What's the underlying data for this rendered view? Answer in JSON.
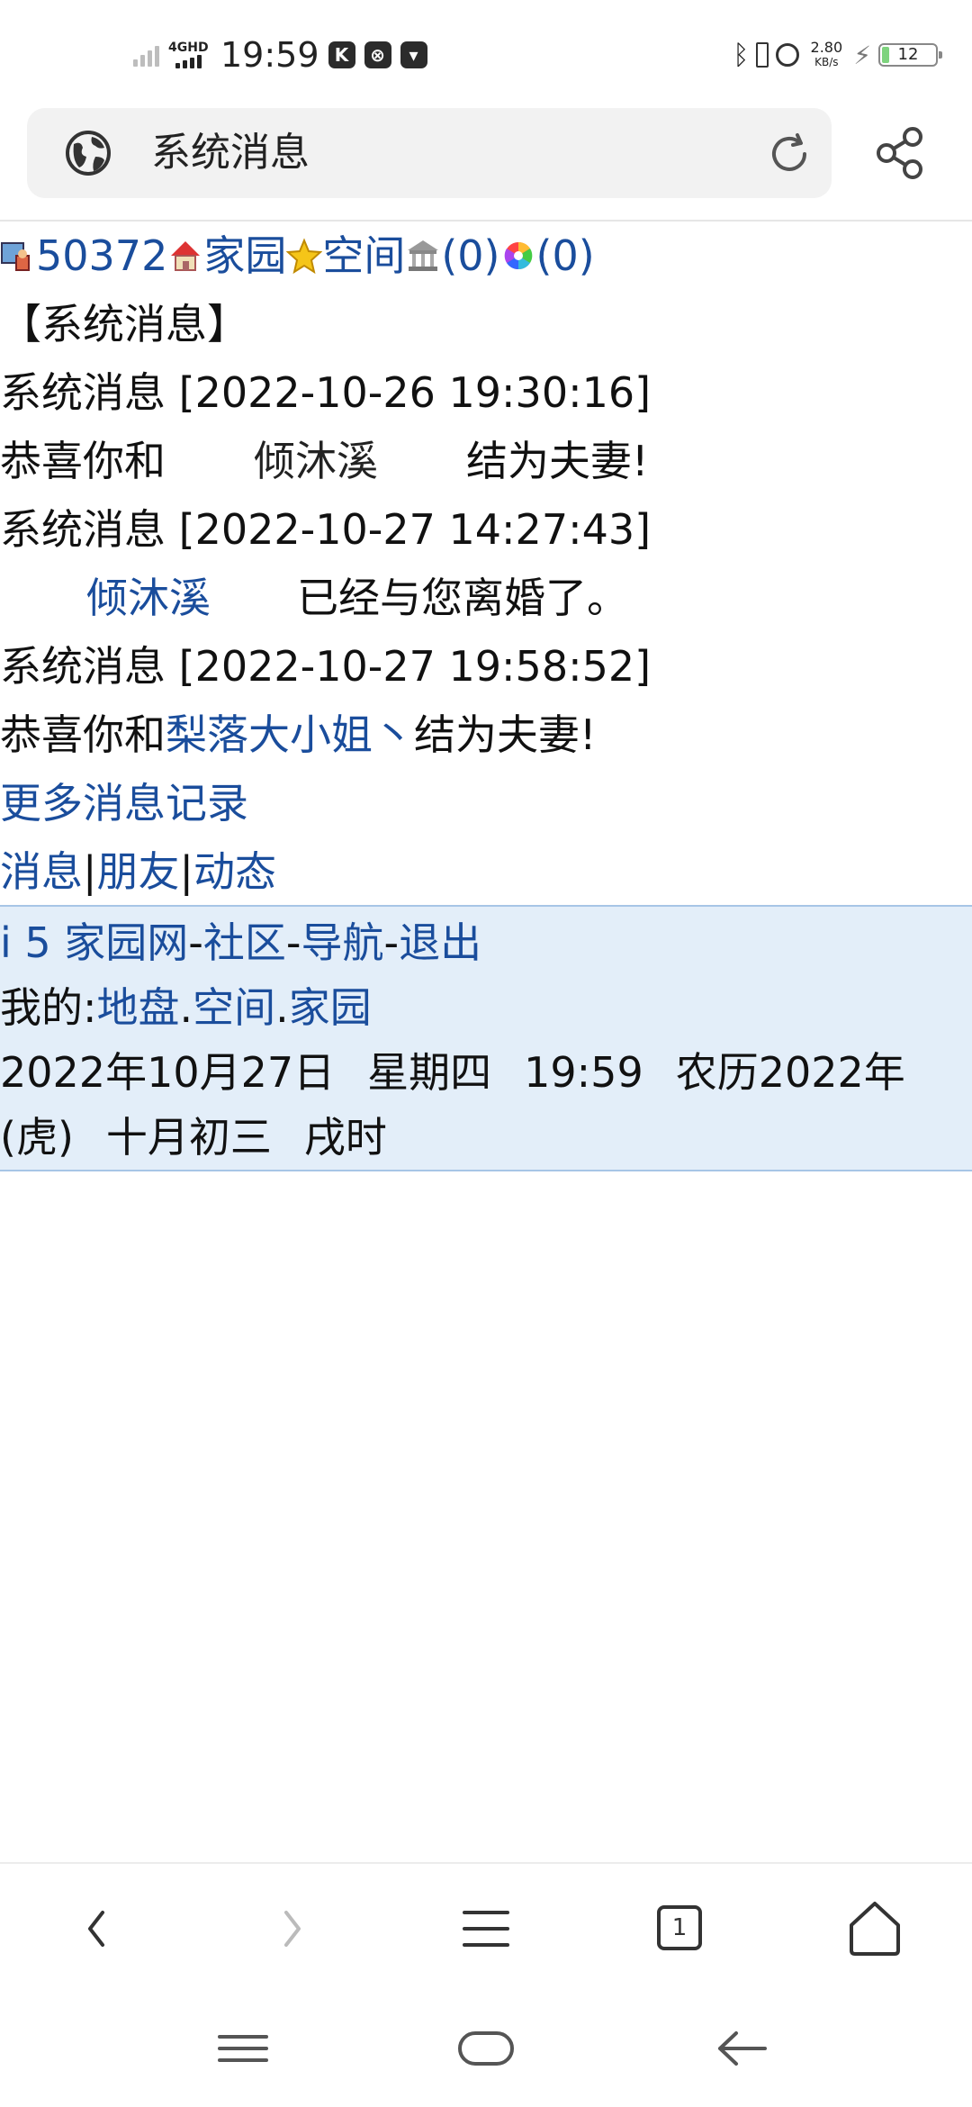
{
  "status_bar": {
    "network": "4GHD",
    "time": "19:59",
    "app_icons": [
      "K",
      "⊗",
      "▾"
    ],
    "speed_value": "2.80",
    "speed_unit": "KB/s",
    "battery": "12"
  },
  "url_bar": {
    "title": "系统消息",
    "icons": [
      "globe-icon",
      "reload-icon",
      "share-icon"
    ]
  },
  "page": {
    "top_nav": {
      "user_id": "50372",
      "home_link": "家园",
      "space_link": "空间",
      "bank_count": "(0)",
      "color_count": "(0)"
    },
    "heading": "【系统消息】",
    "messages": [
      {
        "header": "系统消息 [2022-10-26 19:30:16]",
        "prefix": "恭喜你和",
        "name": "倾沐溪",
        "name_linked": false,
        "suffix": "结为夫妻!"
      },
      {
        "header": "系统消息 [2022-10-27 14:27:43]",
        "prefix": "",
        "name": "倾沐溪",
        "name_linked": true,
        "suffix": "已经与您离婚了。"
      },
      {
        "header": "系统消息 [2022-10-27 19:58:52]",
        "prefix": "恭喜你和",
        "name": "梨落大小姐丶",
        "name_linked": true,
        "suffix": "结为夫妻!"
      }
    ],
    "more_link": "更多消息记录",
    "tabs": [
      "消息",
      "朋友",
      "动态"
    ],
    "tab_sep": "|"
  },
  "footer": {
    "site": "i 5 家园网",
    "community": "社区",
    "nav": "导航",
    "logout": "退出",
    "dash": "-",
    "my_label": "我的:",
    "my_links": [
      "地盘",
      "空间",
      "家园"
    ],
    "dot": ".",
    "date": "2022年10月27日",
    "weekday": "星期四",
    "time": "19:59",
    "lunar_year": "农历2022年",
    "zodiac": "(虎)",
    "lunar_date": "十月初三",
    "hour": "戌时"
  },
  "toolbar": {
    "tab_count": "1",
    "icons": [
      "back-icon",
      "forward-icon",
      "menu-icon",
      "tabs-icon",
      "home-icon"
    ]
  },
  "colors": {
    "link": "#1a4d9c",
    "footer_bg": "#e3eef9",
    "footer_border": "#a7c5e6"
  }
}
